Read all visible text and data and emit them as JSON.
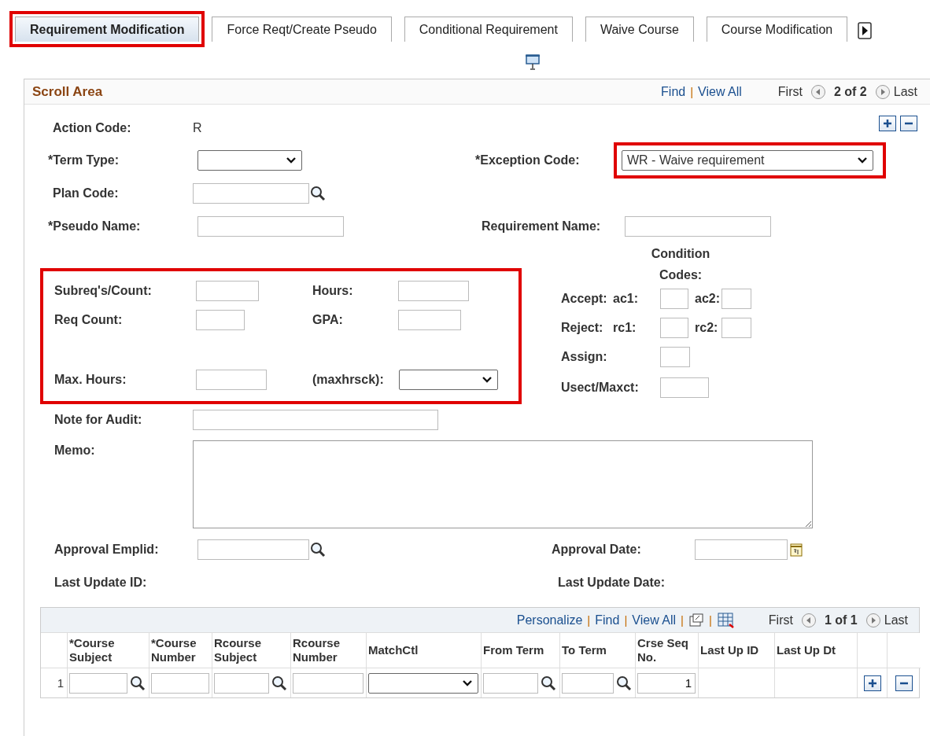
{
  "tabs": [
    {
      "label": "Requirement Modification",
      "selected": true,
      "highlighted": true
    },
    {
      "label": "Force Reqt/Create Pseudo",
      "selected": false,
      "highlighted": false
    },
    {
      "label": "Conditional Requirement",
      "selected": false,
      "highlighted": false
    },
    {
      "label": "Waive Course",
      "selected": false,
      "highlighted": false
    },
    {
      "label": "Course Modification",
      "selected": false,
      "highlighted": false
    }
  ],
  "scroll_area": {
    "title": "Scroll Area",
    "find": "Find",
    "separator": "|",
    "view_all": "View All",
    "first": "First",
    "count": "2 of 2",
    "last": "Last"
  },
  "form": {
    "action_code": {
      "label": "Action Code:",
      "value": "R"
    },
    "term_type": {
      "label": "*Term Type:"
    },
    "exception_code": {
      "label": "*Exception Code:",
      "value": "WR - Waive requirement",
      "highlighted": true
    },
    "plan_code": {
      "label": "Plan Code:"
    },
    "pseudo_name": {
      "label": "*Pseudo Name:"
    },
    "requirement_name": {
      "label": "Requirement Name:"
    },
    "counts": {
      "highlighted": true,
      "subreqs_count": "Subreq's/Count:",
      "hours": "Hours:",
      "req_count": "Req Count:",
      "gpa": "GPA:",
      "max_hours": "Max. Hours:",
      "maxhrsck": "(maxhrsck):"
    },
    "condition_codes": {
      "heading": "Condition Codes:",
      "accept": "Accept:",
      "ac1": "ac1:",
      "ac2": "ac2:",
      "reject": "Reject:",
      "rc1": "rc1:",
      "rc2": "rc2:",
      "assign": "Assign:",
      "usect_maxct": "Usect/Maxct:"
    },
    "note_for_audit": {
      "label": "Note for Audit:"
    },
    "memo": {
      "label": "Memo:"
    },
    "approval_emplid": {
      "label": "Approval Emplid:"
    },
    "approval_date": {
      "label": "Approval Date:"
    },
    "last_update_id": {
      "label": "Last Update ID:"
    },
    "last_update_date": {
      "label": "Last Update Date:"
    }
  },
  "grid": {
    "personalize": "Personalize",
    "find": "Find",
    "view_all": "View All",
    "separator": "|",
    "first": "First",
    "count": "1 of 1",
    "last": "Last",
    "columns": [
      {
        "label": "*Course Subject",
        "kind": "lookup"
      },
      {
        "label": "*Course Number",
        "kind": "text"
      },
      {
        "label": "Rcourse Subject",
        "kind": "lookup"
      },
      {
        "label": "Rcourse Number",
        "kind": "text"
      },
      {
        "label": "MatchCtl",
        "kind": "select"
      },
      {
        "label": "From Term",
        "kind": "lookup"
      },
      {
        "label": "To Term",
        "kind": "lookup"
      },
      {
        "label": "Crse Seq No.",
        "kind": "value"
      },
      {
        "label": "Last Up ID",
        "kind": "empty"
      },
      {
        "label": "Last Up Dt",
        "kind": "empty"
      }
    ],
    "rows": [
      {
        "number": "1",
        "crse_seq_no": "1"
      }
    ]
  }
}
